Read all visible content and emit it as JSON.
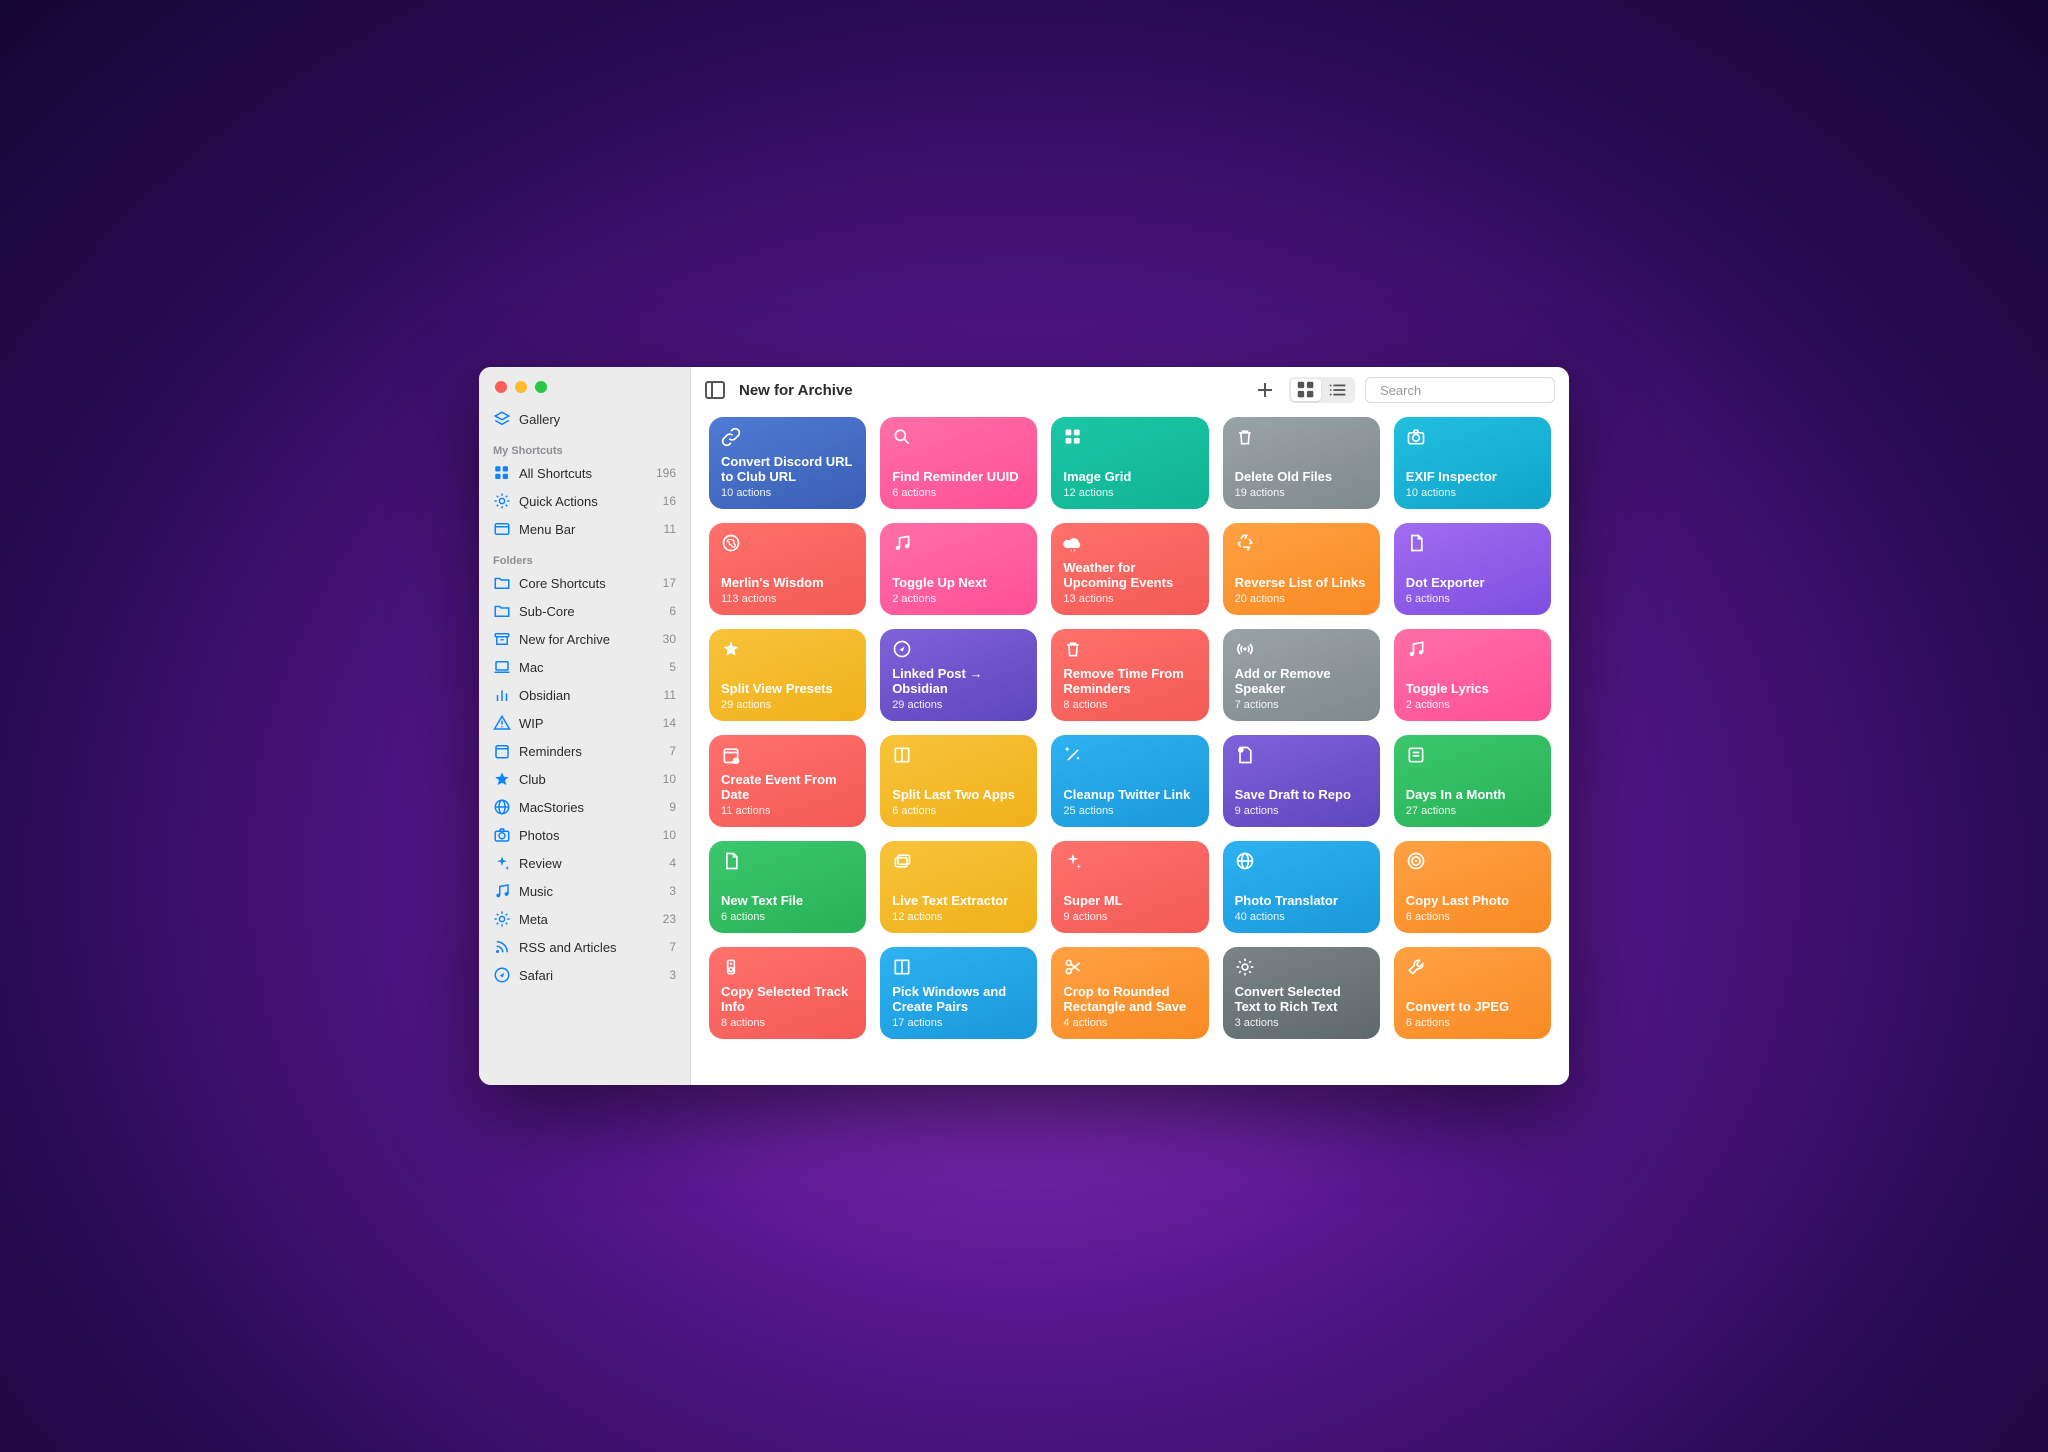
{
  "header": {
    "title": "New for Archive",
    "search_placeholder": "Search"
  },
  "sidebar": {
    "gallery_label": "Gallery",
    "section_my": "My Shortcuts",
    "section_folders": "Folders",
    "my_items": [
      {
        "icon": "grid-four-icon",
        "label": "All Shortcuts",
        "count": "196"
      },
      {
        "icon": "gear-icon",
        "label": "Quick Actions",
        "count": "16"
      },
      {
        "icon": "menubar-icon",
        "label": "Menu Bar",
        "count": "11"
      }
    ],
    "folders": [
      {
        "icon": "folder-icon",
        "label": "Core Shortcuts",
        "count": "17"
      },
      {
        "icon": "folder-icon",
        "label": "Sub-Core",
        "count": "6"
      },
      {
        "icon": "archive-icon",
        "label": "New for Archive",
        "count": "30"
      },
      {
        "icon": "laptop-icon",
        "label": "Mac",
        "count": "5"
      },
      {
        "icon": "chart-icon",
        "label": "Obsidian",
        "count": "11"
      },
      {
        "icon": "warning-icon",
        "label": "WIP",
        "count": "14"
      },
      {
        "icon": "calendar-icon",
        "label": "Reminders",
        "count": "7"
      },
      {
        "icon": "star-icon",
        "label": "Club",
        "count": "10"
      },
      {
        "icon": "globe-icon",
        "label": "MacStories",
        "count": "9"
      },
      {
        "icon": "camera-icon",
        "label": "Photos",
        "count": "10"
      },
      {
        "icon": "sparkle-icon",
        "label": "Review",
        "count": "4"
      },
      {
        "icon": "music-icon",
        "label": "Music",
        "count": "3"
      },
      {
        "icon": "gear-icon",
        "label": "Meta",
        "count": "23"
      },
      {
        "icon": "rss-icon",
        "label": "RSS and Articles",
        "count": "7"
      },
      {
        "icon": "compass-icon",
        "label": "Safari",
        "count": "3"
      }
    ]
  },
  "cards": [
    {
      "title": "Convert Discord URL to Club URL",
      "actions": 10,
      "color": "g-blue",
      "icon": "link-icon"
    },
    {
      "title": "Find Reminder UUID",
      "actions": 6,
      "color": "g-pink",
      "icon": "search-icon"
    },
    {
      "title": "Image Grid",
      "actions": 12,
      "color": "g-teal",
      "icon": "grid-four-icon"
    },
    {
      "title": "Delete Old Files",
      "actions": 19,
      "color": "g-gray",
      "icon": "trash-icon"
    },
    {
      "title": "EXIF Inspector",
      "actions": 10,
      "color": "g-cyan",
      "icon": "camera-icon"
    },
    {
      "title": "Merlin's Wisdom",
      "actions": 113,
      "color": "g-red",
      "icon": "brain-icon"
    },
    {
      "title": "Toggle Up Next",
      "actions": 2,
      "color": "g-pink",
      "icon": "music-icon"
    },
    {
      "title": "Weather for Upcoming Events",
      "actions": 13,
      "color": "g-red",
      "icon": "cloud-icon"
    },
    {
      "title": "Reverse List of Links",
      "actions": 20,
      "color": "g-orange",
      "icon": "recycle-icon"
    },
    {
      "title": "Dot Exporter",
      "actions": 6,
      "color": "g-purple",
      "icon": "document-icon"
    },
    {
      "title": "Split View Presets",
      "actions": 29,
      "color": "g-yellow",
      "icon": "star-icon"
    },
    {
      "title": "Linked Post → Obsidian",
      "actions": 29,
      "color": "g-dpurple",
      "icon": "compass-icon"
    },
    {
      "title": "Remove Time From Reminders",
      "actions": 8,
      "color": "g-red",
      "icon": "trash-icon"
    },
    {
      "title": "Add or Remove Speaker",
      "actions": 7,
      "color": "g-gray",
      "icon": "antenna-icon"
    },
    {
      "title": "Toggle Lyrics",
      "actions": 2,
      "color": "g-pink",
      "icon": "music-icon"
    },
    {
      "title": "Create Event From Date",
      "actions": 11,
      "color": "g-red",
      "icon": "calendar-add-icon"
    },
    {
      "title": "Split Last Two Apps",
      "actions": 6,
      "color": "g-yellow",
      "icon": "book-icon"
    },
    {
      "title": "Cleanup Twitter Link",
      "actions": 25,
      "color": "g-blue2",
      "icon": "wand-icon"
    },
    {
      "title": "Save Draft to Repo",
      "actions": 9,
      "color": "g-dpurple",
      "icon": "page-badge-icon"
    },
    {
      "title": "Days In a Month",
      "actions": 27,
      "color": "g-green",
      "icon": "note-icon"
    },
    {
      "title": "New Text File",
      "actions": 6,
      "color": "g-green",
      "icon": "document-icon"
    },
    {
      "title": "Live Text Extractor",
      "actions": 12,
      "color": "g-yellow",
      "icon": "stack-icon"
    },
    {
      "title": "Super ML",
      "actions": 9,
      "color": "g-red",
      "icon": "sparkle-icon"
    },
    {
      "title": "Photo Translator",
      "actions": 40,
      "color": "g-blue2",
      "icon": "globe-icon"
    },
    {
      "title": "Copy Last Photo",
      "actions": 6,
      "color": "g-orange",
      "icon": "target-icon"
    },
    {
      "title": "Copy Selected Track Info",
      "actions": 8,
      "color": "g-red",
      "icon": "speaker-icon"
    },
    {
      "title": "Pick Windows and Create Pairs",
      "actions": 17,
      "color": "g-blue2",
      "icon": "book-icon"
    },
    {
      "title": "Crop to Rounded Rectangle and Save",
      "actions": 4,
      "color": "g-orange",
      "icon": "scissors-icon"
    },
    {
      "title": "Convert Selected Text to Rich Text",
      "actions": 3,
      "color": "g-dgray",
      "icon": "gear-icon"
    },
    {
      "title": "Convert to JPEG",
      "actions": 6,
      "color": "g-orange",
      "icon": "wrench-icon"
    }
  ],
  "strings": {
    "actions_suffix": "actions"
  }
}
